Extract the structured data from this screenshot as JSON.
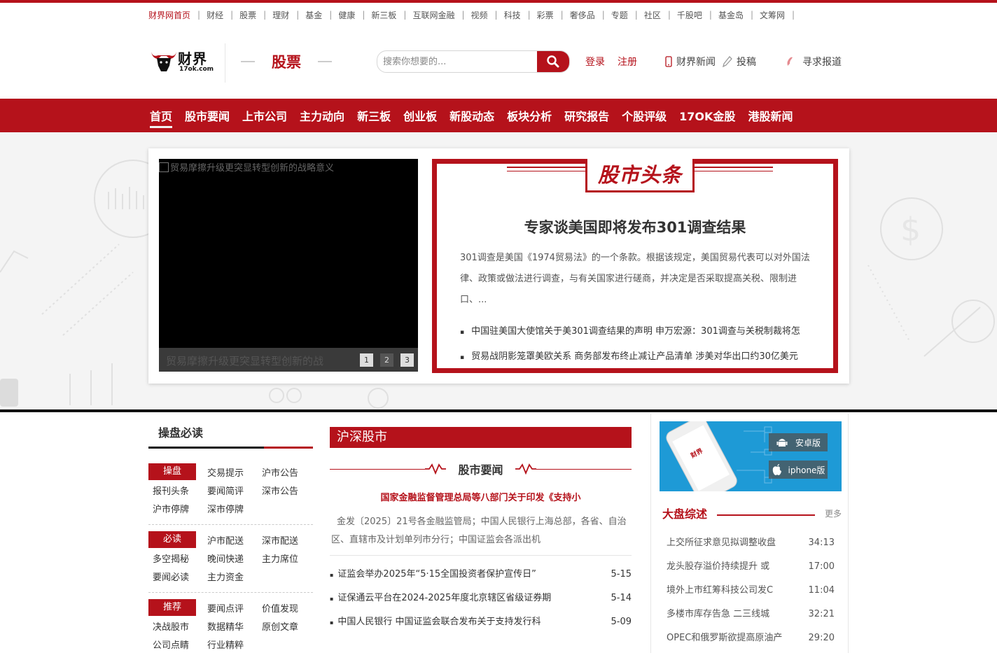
{
  "top_links": [
    "财界网首页",
    "财经",
    "股票",
    "理财",
    "基金",
    "健康",
    "新三板",
    "互联网金融",
    "视频",
    "科技",
    "彩票",
    "奢侈品",
    "专题",
    "社区",
    "千股吧",
    "基金岛",
    "文筹网"
  ],
  "logo": {
    "text": "财界",
    "sub": "17ok.com"
  },
  "channel": "股票",
  "search": {
    "placeholder": "搜索你想要的..."
  },
  "header_links": {
    "login": "登录",
    "register": "注册",
    "news": "财界新闻",
    "submit": "投稿",
    "report": "寻求报道"
  },
  "nav": [
    "首页",
    "股市要闻",
    "上市公司",
    "主力动向",
    "新三板",
    "创业板",
    "新股动态",
    "板块分析",
    "研究报告",
    "个股评级",
    "17OK金股",
    "港股新闻"
  ],
  "slider": {
    "alt": "贸易摩擦升级更突显转型创新的战略意义",
    "caption": "贸易摩擦升级更突显转型创新的战",
    "dots": [
      "1",
      "2",
      "3"
    ]
  },
  "headline": {
    "badge": "股市头条",
    "title": "专家谈美国即将发布301调查结果",
    "summary": "301调查是美国《1974贸易法》的一个条款。根据该规定，美国贸易代表可以对外国法律、政策或做法进行调查，与有关国家进行磋商，并决定是否采取提高关税、限制进口、...",
    "items": [
      "中国驻美国大使馆关于美301调查结果的声明 申万宏源：301调查与关税制裁将怎",
      "贸易战阴影笼罩美欧关系 商务部发布终止减让产品清单 涉美对华出口约30亿美元"
    ]
  },
  "caopan": {
    "title": "操盘必读",
    "groups": [
      {
        "tag": "操盘",
        "rows": [
          [
            "交易提示",
            "沪市公告"
          ],
          [
            "报刊头条",
            "要闻简评",
            "深市公告"
          ],
          [
            "沪市停牌",
            "深市停牌"
          ]
        ]
      },
      {
        "tag": "必读",
        "rows": [
          [
            "沪市配送",
            "深市配送"
          ],
          [
            "多空揭秘",
            "晚间快递",
            "主力席位"
          ],
          [
            "要闻必读",
            "主力资金"
          ]
        ]
      },
      {
        "tag": "推荐",
        "rows": [
          [
            "要闻点评",
            "价值发现"
          ],
          [
            "决战股市",
            "数据精华",
            "原创文章"
          ],
          [
            "公司点睛",
            "行业精粹"
          ]
        ]
      }
    ]
  },
  "hushen": {
    "title": "沪深股市",
    "subtitle": "股市要闻",
    "lead_title": "国家金融监督管理总局等八部门关于印发《支持小",
    "lead_text": "金发〔2025〕21号各金融监管局；中国人民银行上海总部，各省、自治区、直辖市及计划单列市分行；中国证监会各派出机",
    "news": [
      {
        "title": "证监会举办2025年“5·15全国投资者保护宣传日”",
        "date": "5-15"
      },
      {
        "title": "证保通云平台在2024-2025年度北京辖区省级证券期",
        "date": "5-14"
      },
      {
        "title": "中国人民银行 中国证监会联合发布关于支持发行科",
        "date": "5-09"
      }
    ]
  },
  "app": {
    "android": "安卓版",
    "iphone": "iphone版"
  },
  "dapan": {
    "title": "大盘综述",
    "more": "更多",
    "items": [
      {
        "title": "上交所征求意见拟调整收盘",
        "time": "34:13"
      },
      {
        "title": "龙头股存溢价持续提升 或",
        "time": "17:00"
      },
      {
        "title": "境外上市红筹科技公司发C",
        "time": "11:04"
      },
      {
        "title": "多楼市库存告急 二三线城",
        "time": "32:21"
      },
      {
        "title": "OPEC和俄罗斯欲提高原油产",
        "time": "29:20"
      }
    ]
  },
  "colors": {
    "brand": "#b5121b",
    "black": "#111111"
  }
}
